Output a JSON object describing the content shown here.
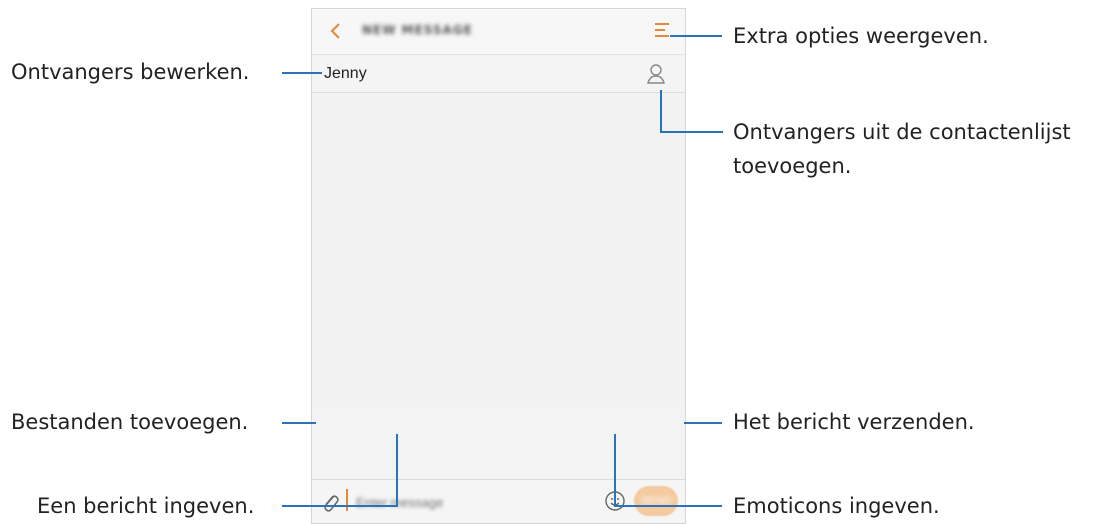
{
  "phone": {
    "back_icon": "chevron-left-icon",
    "title": "NEW MESSAGE",
    "menu_icon": "menu-icon",
    "recipient": "Jenny",
    "contacts_icon": "contact-icon",
    "attach_icon": "paperclip-icon",
    "message_placeholder": "Enter message",
    "emoji_icon": "smiley-icon",
    "send_label": "SEND",
    "accent_color": "#e08a3a",
    "send_color": "#f4caa0"
  },
  "callouts": {
    "more_options": "Extra opties weergeven.",
    "edit_recipients": "Ontvangers bewerken.",
    "add_from_contacts_line1": "Ontvangers uit de contactenlijst",
    "add_from_contacts_line2": "toevoegen.",
    "attach_files": "Bestanden toevoegen.",
    "send_message": "Het bericht verzenden.",
    "enter_message": "Een bericht ingeven.",
    "enter_emoticons": "Emoticons ingeven."
  },
  "line_color": "#2a73b8"
}
